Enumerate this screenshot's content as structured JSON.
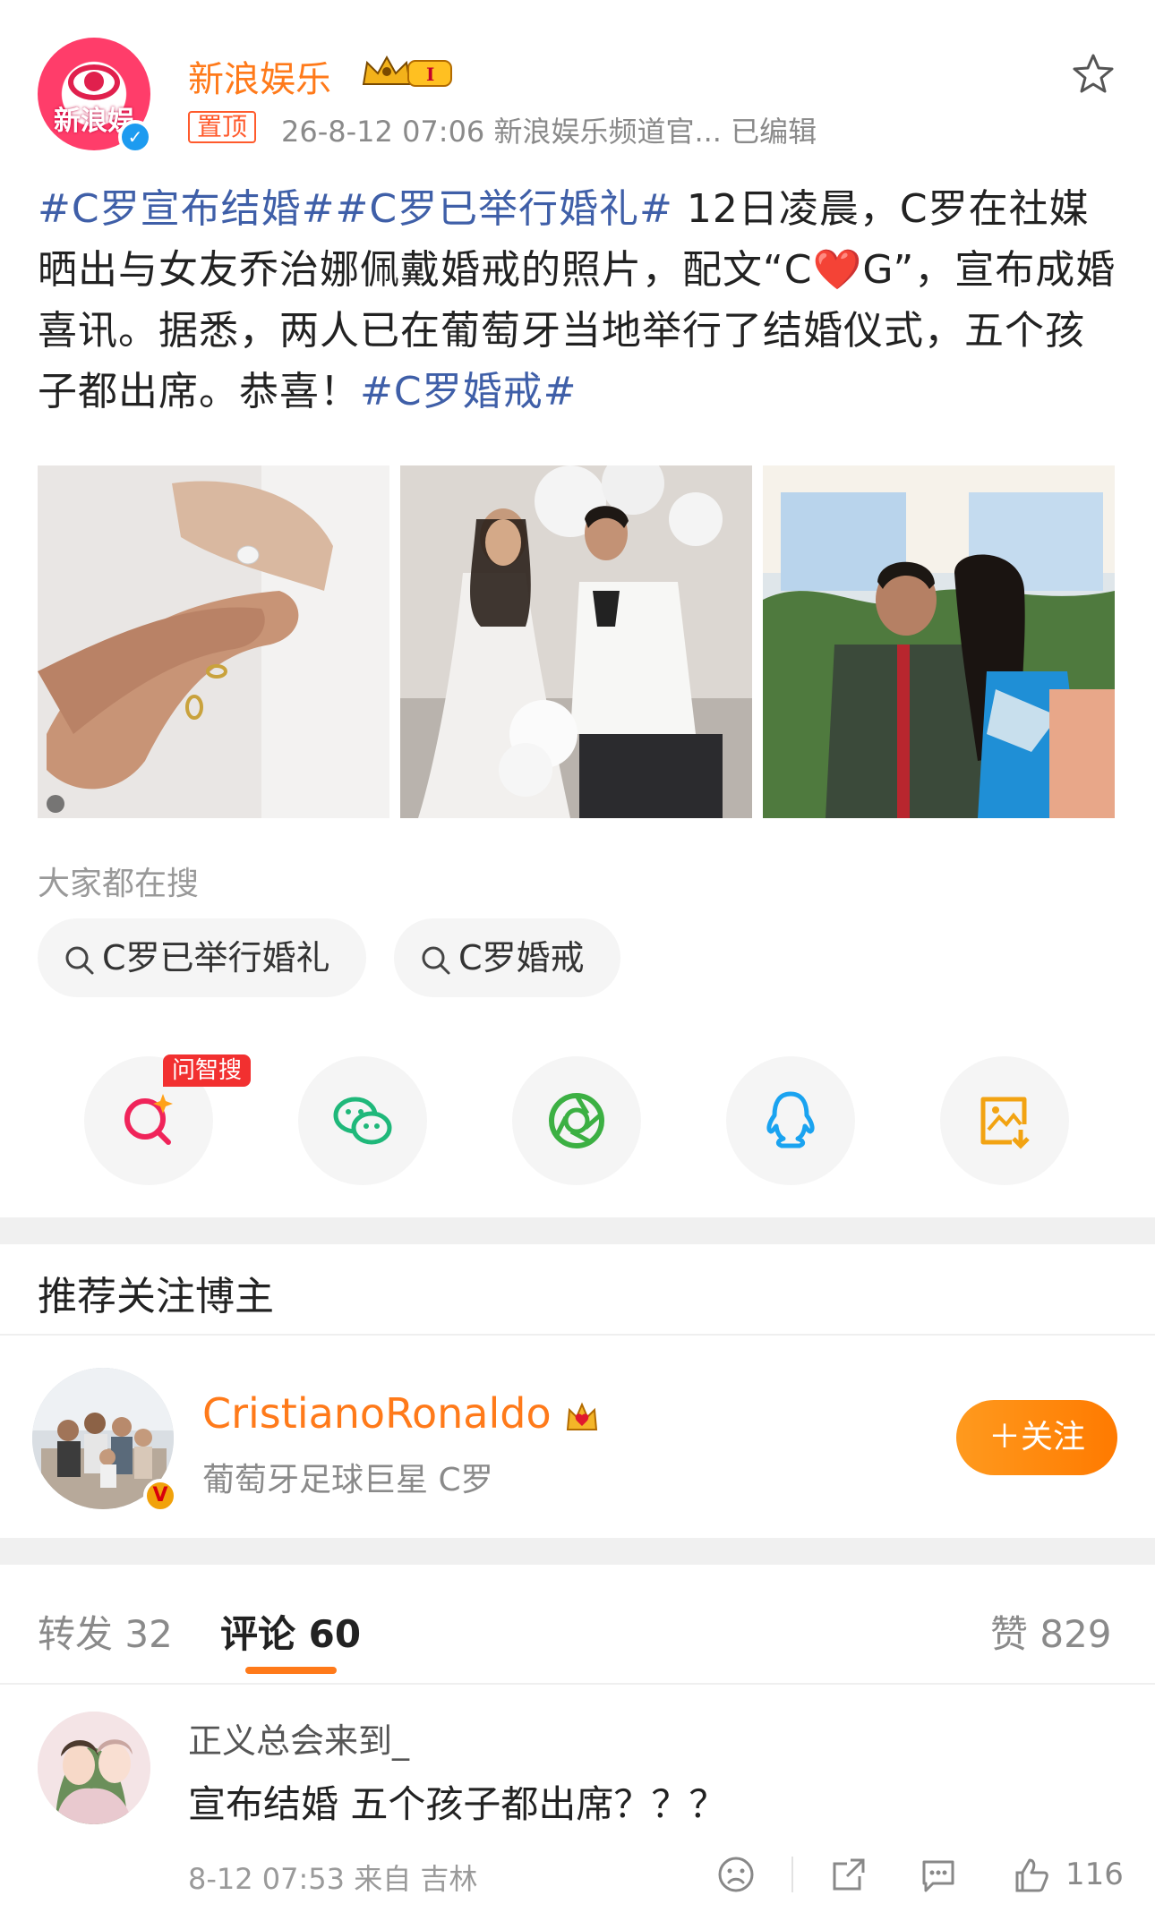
{
  "post": {
    "username": "新浪娱乐",
    "avatar_text": "新浪娱",
    "pin_label": "置顶",
    "meta": "26-8-12 07:06  新浪娱乐频道官...  已编辑",
    "text_tag1": "#C罗宣布结婚##C罗已举行婚礼#",
    "text_body1": " 12日凌晨，C罗在社媒晒出与女友乔治娜佩戴婚戒的照片，配文“C",
    "text_heart": "❤️",
    "text_body2": "G”，宣布成婚喜讯。据悉，两人已在葡萄牙当地举行了结婚仪式，五个孩子都出席。恭喜！",
    "text_tag2": "#C罗婚戒#",
    "photos": [
      "hands-with-rings-photo",
      "wedding-couple-photo",
      "couple-outdoor-photo"
    ]
  },
  "search": {
    "label": "大家都在搜",
    "chips": [
      "C罗已举行婚礼",
      "C罗婚戒"
    ]
  },
  "share": {
    "zhisou_badge": "问智搜",
    "icons": [
      "ai-search-icon",
      "wechat-icon",
      "moments-icon",
      "qq-icon",
      "save-image-icon"
    ]
  },
  "recommend": {
    "title": "推荐关注博主",
    "name": "CristianoRonaldo",
    "desc": "葡萄牙足球巨星 C罗",
    "follow": "＋关注",
    "badge": "V"
  },
  "tabs": {
    "repost": "转发 32",
    "comment": "评论 60",
    "like": "赞 829"
  },
  "comment": {
    "name": "正义总会来到_",
    "text": "宣布结婚  五个孩子都出席？？？",
    "meta": "8-12 07:53 来自 吉林",
    "likes": "116"
  },
  "colors": {
    "accent": "#ff7a1a",
    "tag": "#3f5fa8",
    "pin": "#ff5a2c"
  }
}
